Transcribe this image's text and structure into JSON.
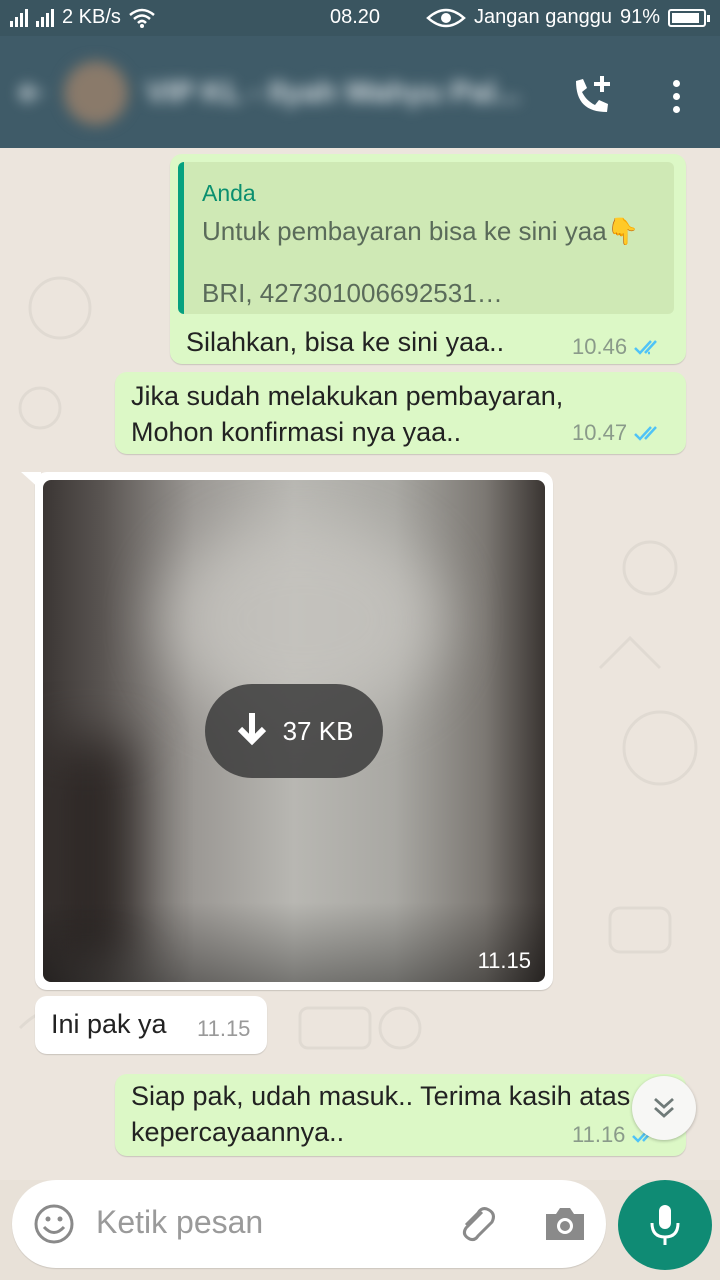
{
  "status_bar": {
    "speed": "2 KB/s",
    "time": "08.20",
    "dnd": "Jangan ganggu",
    "battery_text": "91%",
    "battery_level": 0.91
  },
  "header": {
    "contact_name": "VIP KL - Ilyah Wahyu Pal..."
  },
  "messages": {
    "m1": {
      "quote_author": "Anda",
      "quote_line1": "Untuk pembayaran bisa ke sini yaa👇",
      "quote_line2": "BRI, 427301006692531…",
      "text": "Silahkan, bisa ke sini yaa..",
      "time": "10.46"
    },
    "m2": {
      "line1": "Jika sudah melakukan pembayaran,",
      "line2": "Mohon konfirmasi nya yaa..",
      "time": "10.47"
    },
    "m3": {
      "size": "37 KB",
      "time": "11.15"
    },
    "m4": {
      "text": "Ini pak ya",
      "time": "11.15"
    },
    "m5": {
      "line1": "Siap pak, udah masuk.. Terima kasih atas",
      "line2": "kepercayaannya..",
      "time": "11.16"
    }
  },
  "input": {
    "placeholder": "Ketik pesan"
  },
  "colors": {
    "header": "#3f5b68",
    "outgoing_bubble": "#dcf8c6",
    "incoming_bubble": "#ffffff",
    "accent": "#0f8b74",
    "read_ticks": "#4fc3f7"
  },
  "icons": [
    "wifi-icon",
    "eye-icon",
    "battery-icon",
    "add-call-icon",
    "more-vert-icon",
    "read-ticks-icon",
    "download-icon",
    "scroll-down-icon",
    "emoji-icon",
    "attach-icon",
    "camera-icon",
    "mic-icon"
  ]
}
